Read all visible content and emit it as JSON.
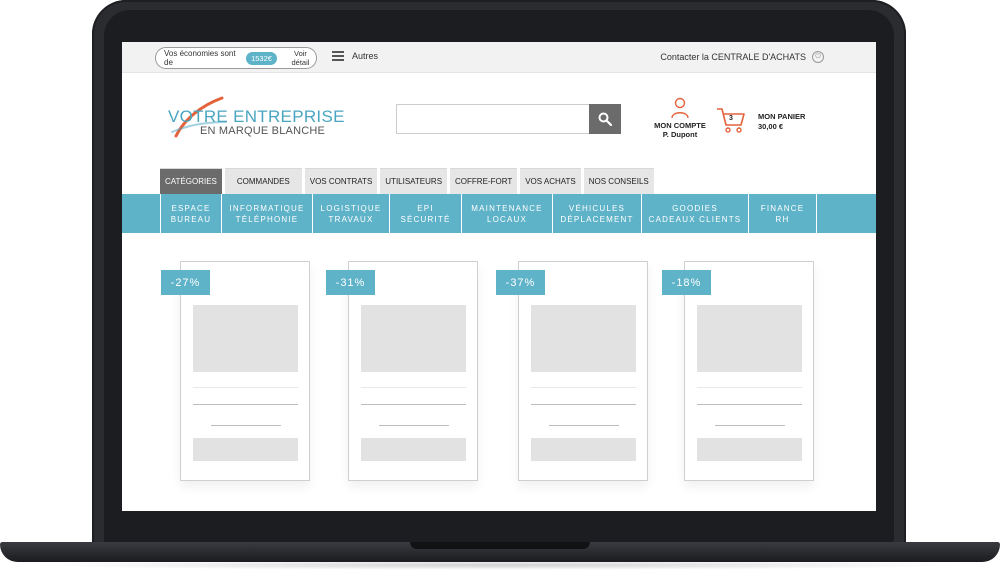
{
  "colors": {
    "accent": "#5fb3c8",
    "tab_active": "#6b6b6b",
    "laptop": "#2b2c30"
  },
  "topbar": {
    "savings_prefix": "Vos économies sont de",
    "savings_amount": "1532€",
    "savings_detail": "Voir détail",
    "others_label": "Autres",
    "contact_label": "Contacter la CENTRALE D'ACHATS"
  },
  "logo": {
    "line1": "VOTRE ENTREPRISE",
    "line2": "EN MARQUE BLANCHE"
  },
  "search": {
    "placeholder": "",
    "icon": "search-icon"
  },
  "account": {
    "title": "MON COMPTE",
    "user": "P. Dupont"
  },
  "cart": {
    "count": "3",
    "title": "MON PANIER",
    "total": "30,00 €"
  },
  "tabs": [
    {
      "label": "CATÉGORIES",
      "active": true
    },
    {
      "label": "COMMANDES"
    },
    {
      "label": "VOS CONTRATS"
    },
    {
      "label": "UTILISATEURS"
    },
    {
      "label": "COFFRE-FORT"
    },
    {
      "label": "VOS ACHATS"
    },
    {
      "label": "NOS CONSEILS"
    }
  ],
  "categories": [
    {
      "line1": "ESPACE",
      "line2": "BUREAU"
    },
    {
      "line1": "INFORMATIQUE",
      "line2": "TÉLÉPHONIE"
    },
    {
      "line1": "LOGISTIQUE",
      "line2": "TRAVAUX"
    },
    {
      "line1": "EPI",
      "line2": "SÉCURITÉ"
    },
    {
      "line1": "MAINTENANCE",
      "line2": "LOCAUX"
    },
    {
      "line1": "VÉHICULES",
      "line2": "DÉPLACEMENT"
    },
    {
      "line1": "GOODIES",
      "line2": "CADEAUX CLIENTS"
    },
    {
      "line1": "FINANCE",
      "line2": "RH"
    }
  ],
  "products": [
    {
      "discount": "-27%"
    },
    {
      "discount": "-31%"
    },
    {
      "discount": "-37%"
    },
    {
      "discount": "-18%"
    }
  ]
}
